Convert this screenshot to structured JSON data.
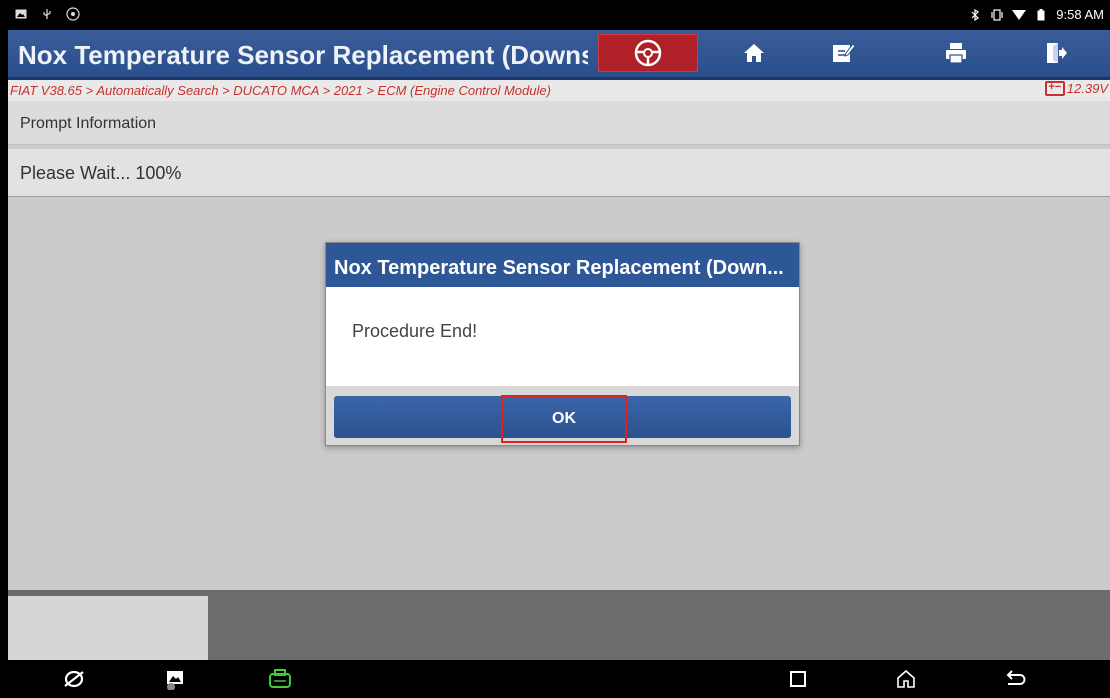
{
  "status_bar": {
    "time": "9:58 AM",
    "icons": [
      "image-icon",
      "usb-icon",
      "settings-circle-icon",
      "bluetooth-icon",
      "vibrate-icon",
      "wifi-icon",
      "battery-icon"
    ]
  },
  "header": {
    "title": "Nox Temperature Sensor Replacement (Downst",
    "buttons": [
      "steering-wheel-icon",
      "home-icon",
      "edit-report-icon",
      "print-icon",
      "exit-icon"
    ]
  },
  "breadcrumb": {
    "path": "FIAT V38.65 > Automatically Search > DUCATO MCA > 2021 > ECM (Engine Control Module)",
    "voltage": "12.39V"
  },
  "main": {
    "section_title": "Prompt Information",
    "status_text": "Please Wait... 100%"
  },
  "dialog": {
    "title": "Nox Temperature Sensor Replacement (Down...",
    "message": "Procedure End!",
    "ok_label": "OK"
  },
  "nav_bar": {
    "items": [
      "browser-icon",
      "gallery-icon",
      "vci-icon",
      "recents-icon",
      "home-nav-icon",
      "back-icon"
    ]
  },
  "colors": {
    "header_blue": "#2b4f8c",
    "breadcrumb_red": "#c8312b",
    "highlight_red": "#e12020",
    "vci_green": "#3ccc3c"
  }
}
